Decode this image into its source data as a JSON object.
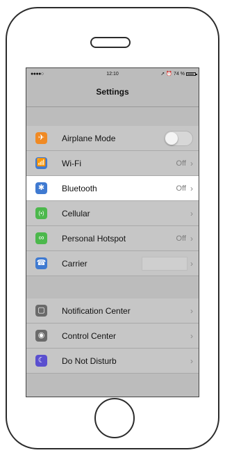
{
  "status": {
    "signal": "●●●●○",
    "time": "12:10",
    "location_arrow": "➚",
    "alarm": "⏰",
    "battery_percent": "74 %"
  },
  "nav": {
    "title": "Settings"
  },
  "groups": [
    [
      {
        "label": "Airplane Mode",
        "icon": "✈",
        "icon_color": "#f08a24",
        "control": "toggle",
        "toggle_on": false
      },
      {
        "label": "Wi-Fi",
        "icon": "📶",
        "icon_color": "#3f7ad1",
        "value": "Off",
        "chevron": "›"
      },
      {
        "label": "Bluetooth",
        "icon": "✱",
        "icon_color": "#3f7ad1",
        "value": "Off",
        "chevron": "›",
        "highlighted": true
      },
      {
        "label": "Cellular",
        "icon": "(•)",
        "icon_color": "#4cb84c",
        "chevron": "›"
      },
      {
        "label": "Personal Hotspot",
        "icon": "∞",
        "icon_color": "#4cb84c",
        "value": "Off",
        "chevron": "›"
      },
      {
        "label": "Carrier",
        "icon": "☎",
        "icon_color": "#3f7ad1",
        "chevron": "›"
      }
    ],
    [
      {
        "label": "Notification Center",
        "icon": "▢",
        "icon_color": "#6a6a6a",
        "chevron": "›"
      },
      {
        "label": "Control Center",
        "icon": "◉",
        "icon_color": "#6a6a6a",
        "chevron": "›"
      },
      {
        "label": "Do Not Disturb",
        "icon": "☾",
        "icon_color": "#5a4fcf",
        "chevron": "›"
      }
    ]
  ]
}
